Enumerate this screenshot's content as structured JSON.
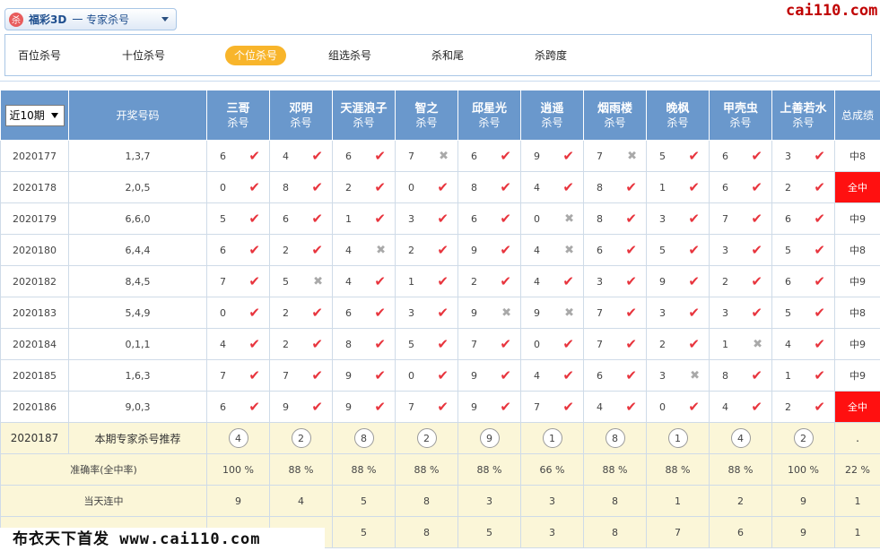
{
  "header": {
    "game_icon": "杀",
    "game_name": "福彩3D",
    "game_mode": "一 专家杀号",
    "watermark": "cai110.com"
  },
  "tabs": [
    {
      "label": "百位杀号",
      "active": false
    },
    {
      "label": "十位杀号",
      "active": false
    },
    {
      "label": "个位杀号",
      "active": true
    },
    {
      "label": "组选杀号",
      "active": false
    },
    {
      "label": "杀和尾",
      "active": false
    },
    {
      "label": "杀跨度",
      "active": false
    }
  ],
  "table": {
    "period_select": "近10期",
    "draw_header": "开奖号码",
    "total_header": "总成绩",
    "expert_sub": "杀号",
    "experts": [
      "三哥",
      "邓明",
      "天涯浪子",
      "智之",
      "邱星光",
      "逍遥",
      "烟雨楼",
      "晚枫",
      "甲壳虫",
      "上善若水"
    ],
    "rows": [
      {
        "period": "2020177",
        "draw": "1,3,7",
        "cells": [
          [
            "6",
            1
          ],
          [
            "4",
            1
          ],
          [
            "6",
            1
          ],
          [
            "7",
            0
          ],
          [
            "6",
            1
          ],
          [
            "9",
            1
          ],
          [
            "7",
            0
          ],
          [
            "5",
            1
          ],
          [
            "6",
            1
          ],
          [
            "3",
            1
          ]
        ],
        "total": "中8",
        "full": false
      },
      {
        "period": "2020178",
        "draw": "2,0,5",
        "cells": [
          [
            "0",
            1
          ],
          [
            "8",
            1
          ],
          [
            "2",
            1
          ],
          [
            "0",
            1
          ],
          [
            "8",
            1
          ],
          [
            "4",
            1
          ],
          [
            "8",
            1
          ],
          [
            "1",
            1
          ],
          [
            "6",
            1
          ],
          [
            "2",
            1
          ]
        ],
        "total": "全中",
        "full": true
      },
      {
        "period": "2020179",
        "draw": "6,6,0",
        "cells": [
          [
            "5",
            1
          ],
          [
            "6",
            1
          ],
          [
            "1",
            1
          ],
          [
            "3",
            1
          ],
          [
            "6",
            1
          ],
          [
            "0",
            0
          ],
          [
            "8",
            1
          ],
          [
            "3",
            1
          ],
          [
            "7",
            1
          ],
          [
            "6",
            1
          ]
        ],
        "total": "中9",
        "full": false
      },
      {
        "period": "2020180",
        "draw": "6,4,4",
        "cells": [
          [
            "6",
            1
          ],
          [
            "2",
            1
          ],
          [
            "4",
            0
          ],
          [
            "2",
            1
          ],
          [
            "9",
            1
          ],
          [
            "4",
            0
          ],
          [
            "6",
            1
          ],
          [
            "5",
            1
          ],
          [
            "3",
            1
          ],
          [
            "5",
            1
          ]
        ],
        "total": "中8",
        "full": false
      },
      {
        "period": "2020182",
        "draw": "8,4,5",
        "cells": [
          [
            "7",
            1
          ],
          [
            "5",
            0
          ],
          [
            "4",
            1
          ],
          [
            "1",
            1
          ],
          [
            "2",
            1
          ],
          [
            "4",
            1
          ],
          [
            "3",
            1
          ],
          [
            "9",
            1
          ],
          [
            "2",
            1
          ],
          [
            "6",
            1
          ]
        ],
        "total": "中9",
        "full": false
      },
      {
        "period": "2020183",
        "draw": "5,4,9",
        "cells": [
          [
            "0",
            1
          ],
          [
            "2",
            1
          ],
          [
            "6",
            1
          ],
          [
            "3",
            1
          ],
          [
            "9",
            0
          ],
          [
            "9",
            0
          ],
          [
            "7",
            1
          ],
          [
            "3",
            1
          ],
          [
            "3",
            1
          ],
          [
            "5",
            1
          ]
        ],
        "total": "中8",
        "full": false
      },
      {
        "period": "2020184",
        "draw": "0,1,1",
        "cells": [
          [
            "4",
            1
          ],
          [
            "2",
            1
          ],
          [
            "8",
            1
          ],
          [
            "5",
            1
          ],
          [
            "7",
            1
          ],
          [
            "0",
            1
          ],
          [
            "7",
            1
          ],
          [
            "2",
            1
          ],
          [
            "1",
            0
          ],
          [
            "4",
            1
          ]
        ],
        "total": "中9",
        "full": false
      },
      {
        "period": "2020185",
        "draw": "1,6,3",
        "cells": [
          [
            "7",
            1
          ],
          [
            "7",
            1
          ],
          [
            "9",
            1
          ],
          [
            "0",
            1
          ],
          [
            "9",
            1
          ],
          [
            "4",
            1
          ],
          [
            "6",
            1
          ],
          [
            "3",
            0
          ],
          [
            "8",
            1
          ],
          [
            "1",
            1
          ]
        ],
        "total": "中9",
        "full": false
      },
      {
        "period": "2020186",
        "draw": "9,0,3",
        "cells": [
          [
            "6",
            1
          ],
          [
            "9",
            1
          ],
          [
            "9",
            1
          ],
          [
            "7",
            1
          ],
          [
            "9",
            1
          ],
          [
            "7",
            1
          ],
          [
            "4",
            1
          ],
          [
            "0",
            1
          ],
          [
            "4",
            1
          ],
          [
            "2",
            1
          ]
        ],
        "total": "全中",
        "full": true
      }
    ],
    "recommend": {
      "period": "2020187",
      "label": "本期专家杀号推荐",
      "values": [
        "4",
        "2",
        "8",
        "2",
        "9",
        "1",
        "8",
        "1",
        "4",
        "2"
      ],
      "total": "."
    },
    "accuracy": {
      "label": "准确率(全中率)",
      "values": [
        "100 %",
        "88 %",
        "88 %",
        "88 %",
        "88 %",
        "66 %",
        "88 %",
        "88 %",
        "88 %",
        "100 %"
      ],
      "total": "22 %"
    },
    "streak": {
      "label": "当天连中",
      "values": [
        "9",
        "4",
        "5",
        "8",
        "3",
        "3",
        "8",
        "1",
        "2",
        "9"
      ],
      "total": "1"
    },
    "last_row": {
      "values": [
        "",
        "",
        "5",
        "8",
        "5",
        "3",
        "8",
        "7",
        "6",
        "9"
      ],
      "total": "1"
    }
  },
  "footer": {
    "watermark": "布衣天下首发 www.cai110.com"
  }
}
